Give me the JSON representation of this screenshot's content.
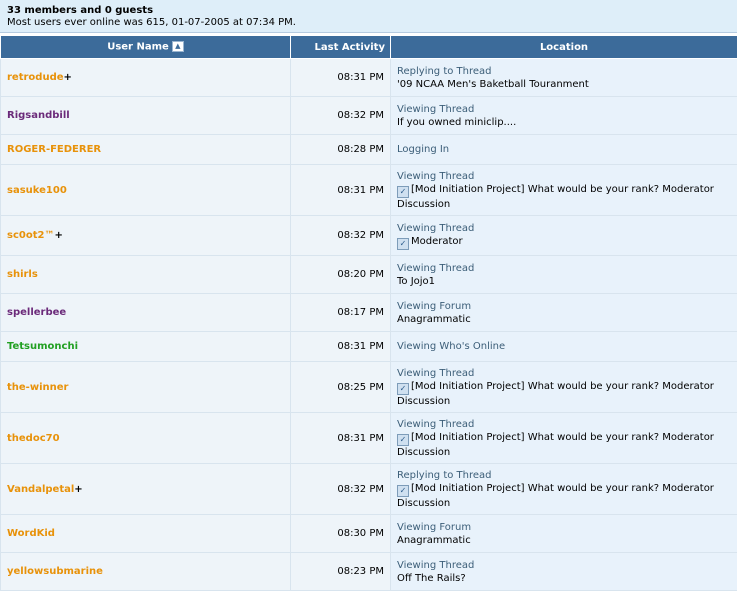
{
  "summary": {
    "title": "33 members and 0 guests",
    "record": "Most users ever online was 615, 01-07-2005 at 07:34 PM."
  },
  "columns": {
    "user": "User Name",
    "activity": "Last Activity",
    "location": "Location"
  },
  "colors": {
    "header_bg": "#3c6b9a",
    "orange": "#e8920a",
    "purple": "#6b2a7a",
    "green": "#22a022"
  },
  "rows": [
    {
      "name": "retrodude",
      "plus": "+",
      "color": "#e8920a",
      "time": "08:31 PM",
      "action": "Replying to Thread",
      "thread": "'09 NCAA Men's Baketball Touranment",
      "icon": false
    },
    {
      "name": "Rigsandbill",
      "plus": "",
      "color": "#6b2a7a",
      "time": "08:32 PM",
      "action": "Viewing Thread",
      "thread": "If you owned miniclip....",
      "icon": false
    },
    {
      "name": "ROGER-FEDERER",
      "plus": "",
      "color": "#e8920a",
      "time": "08:28 PM",
      "action": "Logging In",
      "thread": "",
      "icon": false
    },
    {
      "name": "sasuke100",
      "plus": "",
      "color": "#e8920a",
      "time": "08:31 PM",
      "action": "Viewing Thread",
      "thread": "[Mod Initiation Project] What would be your rank? Moderator Discussion",
      "icon": true
    },
    {
      "name": "sc0ot2™",
      "plus": "+",
      "color": "#e8920a",
      "time": "08:32 PM",
      "action": "Viewing Thread",
      "thread": "Moderator",
      "icon": true
    },
    {
      "name": "shirls",
      "plus": "",
      "color": "#e8920a",
      "time": "08:20 PM",
      "action": "Viewing Thread",
      "thread": "To Jojo1",
      "icon": false
    },
    {
      "name": "spellerbee",
      "plus": "",
      "color": "#6b2a7a",
      "time": "08:17 PM",
      "action": "Viewing Forum",
      "thread": "Anagrammatic",
      "icon": false
    },
    {
      "name": "Tetsumonchi",
      "plus": "",
      "color": "#22a022",
      "time": "08:31 PM",
      "action": "Viewing Who's Online",
      "thread": "",
      "icon": false
    },
    {
      "name": "the-winner",
      "plus": "",
      "color": "#e8920a",
      "time": "08:25 PM",
      "action": "Viewing Thread",
      "thread": "[Mod Initiation Project] What would be your rank? Moderator Discussion",
      "icon": true
    },
    {
      "name": "thedoc70",
      "plus": "",
      "color": "#e8920a",
      "time": "08:31 PM",
      "action": "Viewing Thread",
      "thread": "[Mod Initiation Project] What would be your rank? Moderator Discussion",
      "icon": true
    },
    {
      "name": "Vandalpetal",
      "plus": "+",
      "color": "#e8920a",
      "time": "08:32 PM",
      "action": "Replying to Thread",
      "thread": "[Mod Initiation Project] What would be your rank? Moderator Discussion",
      "icon": true
    },
    {
      "name": "WordKid",
      "plus": "",
      "color": "#e8920a",
      "time": "08:30 PM",
      "action": "Viewing Forum",
      "thread": "Anagrammatic",
      "icon": false
    },
    {
      "name": "yellowsubmarine",
      "plus": "",
      "color": "#e8920a",
      "time": "08:23 PM",
      "action": "Viewing Thread",
      "thread": "Off The Rails?",
      "icon": false
    }
  ]
}
